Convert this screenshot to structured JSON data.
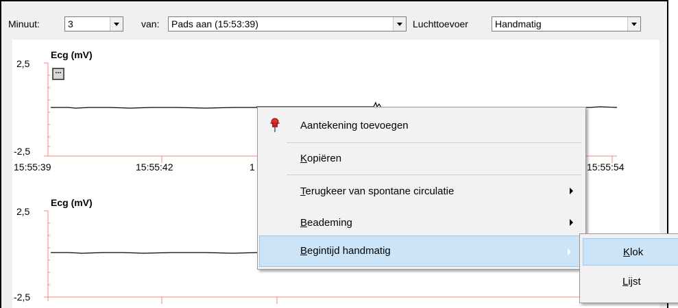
{
  "toolbar": {
    "minute_label": "Minuut:",
    "minute_value": "3",
    "from_label": "van:",
    "from_value": "Pads aan (15:53:39)",
    "air_label": "Luchttoevoer",
    "air_value": "Handmatig"
  },
  "charts": [
    {
      "title": "Ecg (mV)",
      "y_max_label": "2,5",
      "y_min_label": "-2,5",
      "x_ticks": [
        "15:55:39",
        "15:55:42",
        "1",
        "15:55:54"
      ],
      "more_button": "..."
    },
    {
      "title": "Ecg (mV)",
      "y_max_label": "2,5",
      "y_min_label": "-2,5"
    }
  ],
  "context_menu": {
    "items": [
      {
        "label": "Aantekening toevoegen",
        "accel_index": -1,
        "has_submenu": false,
        "icon": "pushpin-icon"
      },
      {
        "label": "Kopiëren",
        "accel_index": 0,
        "has_submenu": false
      },
      {
        "label": "Terugkeer van spontane circulatie",
        "accel_index": 0,
        "has_submenu": true
      },
      {
        "label": "Beademing",
        "accel_index": 0,
        "has_submenu": true
      },
      {
        "label": "Begintijd handmatig",
        "accel_index": 0,
        "has_submenu": true,
        "selected": true
      }
    ],
    "submenu": [
      {
        "label": "Klok",
        "selected": true
      },
      {
        "label": "Lijst",
        "selected": false
      }
    ]
  },
  "colors": {
    "axis": "#ff8080",
    "trace": "#000000",
    "menu_highlight": "#cce4f7",
    "pin": "#e03030"
  }
}
